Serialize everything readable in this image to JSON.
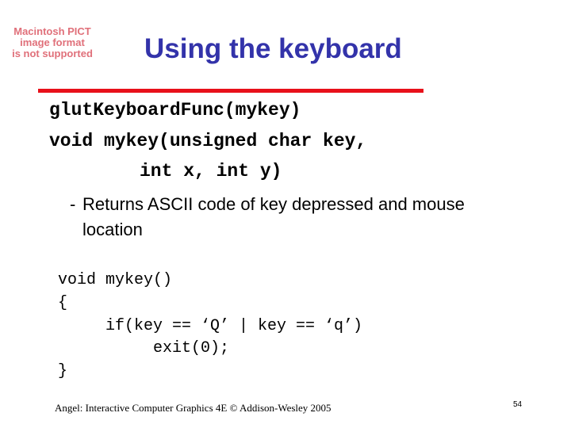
{
  "placeholder_image": {
    "lines": [
      "Macintosh PICT",
      "image format",
      "is not supported"
    ],
    "color": "#e0707a"
  },
  "title": "Using the keyboard",
  "colors": {
    "title": "#3333aa",
    "rule": "#e8101a"
  },
  "code_header": [
    "glutKeyboardFunc(mykey)",
    "void mykey(unsigned char key,",
    "int x, int y)"
  ],
  "bullet": {
    "marker": "-",
    "text": "Returns ASCII code of key depressed and mouse location"
  },
  "code_example": [
    "void mykey()",
    "{",
    "     if(key == ‘Q’ | key == ‘q’)",
    "          exit(0);",
    "}"
  ],
  "footer": {
    "citation": "Angel: Interactive Computer Graphics 4E © Addison-Wesley 2005",
    "page_number": "54"
  }
}
